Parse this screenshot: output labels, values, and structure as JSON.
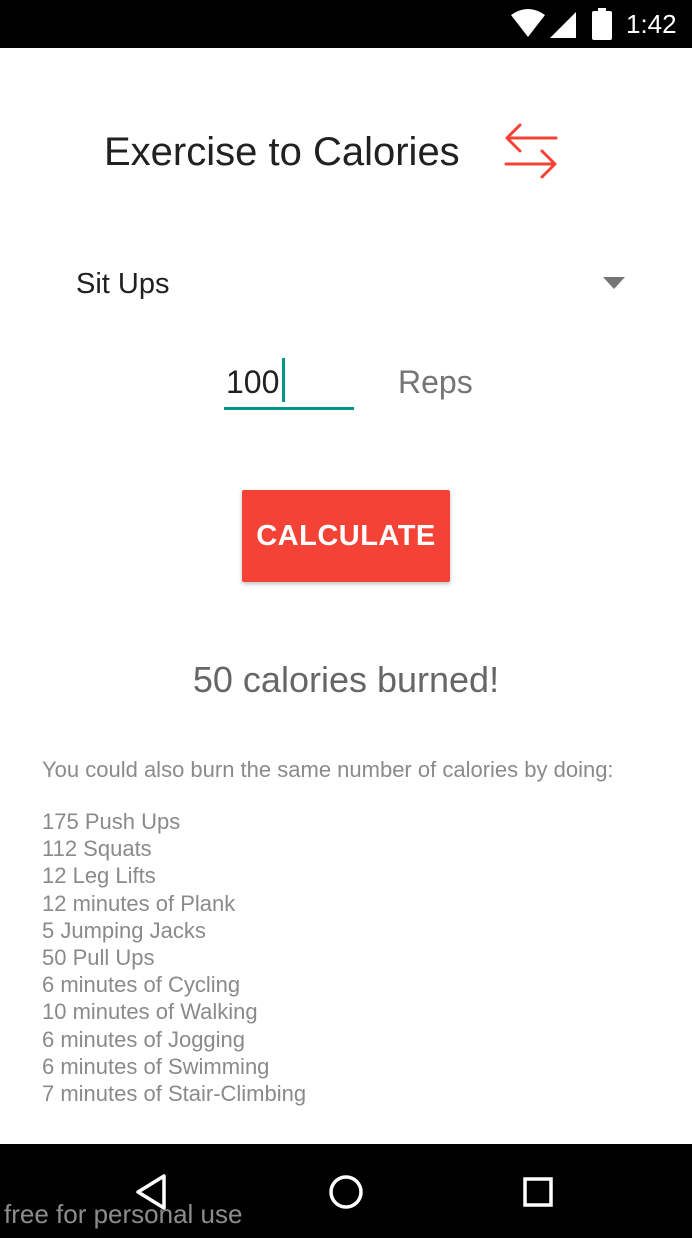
{
  "status_bar": {
    "time": "1:42",
    "icons": [
      "wifi-icon",
      "cell-signal-icon",
      "battery-icon"
    ]
  },
  "header": {
    "title": "Exercise to Calories",
    "swap_icon": "swap-arrows-icon"
  },
  "exercise_select": {
    "selected": "Sit Ups"
  },
  "reps": {
    "value": "100",
    "unit_label": "Reps"
  },
  "calculate_button": {
    "label": "CALCULATE"
  },
  "result": {
    "text": "50 calories burned!"
  },
  "alternatives": {
    "intro": "You could also burn the same number of calories by doing:",
    "items": [
      "175 Push Ups",
      "112 Squats",
      "12 Leg Lifts",
      "12 minutes of Plank",
      "5 Jumping Jacks",
      "50 Pull Ups",
      "6 minutes of Cycling",
      "10 minutes of Walking",
      "6 minutes of Jogging",
      "6 minutes of Swimming",
      "7 minutes of Stair-Climbing"
    ]
  },
  "nav_bar": {
    "buttons": [
      "back-icon",
      "home-icon",
      "recents-icon"
    ]
  },
  "watermark": "free for personal use",
  "colors": {
    "accent": "#f44336",
    "input_underline": "#009688",
    "bars": "#000000"
  }
}
